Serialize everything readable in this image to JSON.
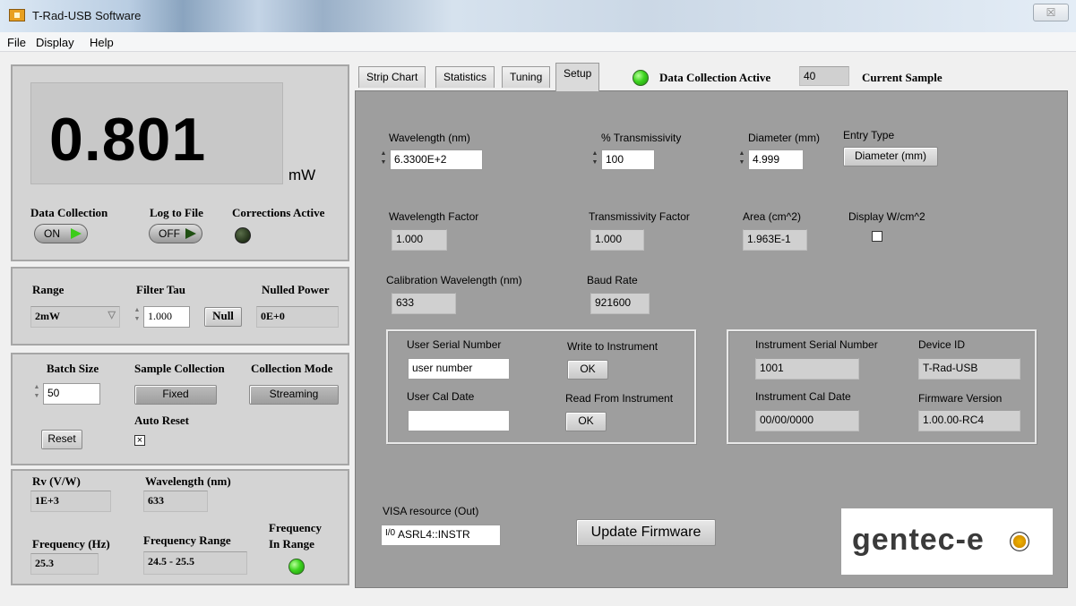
{
  "window": {
    "title": "T-Rad-USB Software",
    "close_glyph": "☒"
  },
  "menu": [
    "File",
    "Display",
    "Help"
  ],
  "power": {
    "value": "0.801",
    "unit": "mW"
  },
  "status": {
    "data_collection_label": "Data Collection",
    "data_collection_state": "ON",
    "log_label": "Log to File",
    "log_state": "OFF",
    "corrections_label": "Corrections Active"
  },
  "range_panel": {
    "range_label": "Range",
    "range_value": "2mW",
    "filter_label": "Filter Tau",
    "filter_value": "1.000",
    "null_button": "Null",
    "nulled_label": "Nulled Power",
    "nulled_value": "0E+0"
  },
  "batch_panel": {
    "batch_label": "Batch Size",
    "batch_value": "50",
    "sample_label": "Sample Collection",
    "sample_button": "Fixed",
    "mode_label": "Collection Mode",
    "mode_button": "Streaming",
    "auto_reset_label": "Auto Reset",
    "auto_reset_mark": "×",
    "reset_button": "Reset"
  },
  "info_panel": {
    "rv_label": "Rv (V/W)",
    "rv_value": "1E+3",
    "wl_label": "Wavelength (nm)",
    "wl_value": "633",
    "freq_label": "Frequency (Hz)",
    "freq_value": "25.3",
    "range_label": "Frequency Range",
    "range_value": "24.5 - 25.5",
    "in_range_label_1": "Frequency",
    "in_range_label_2": "In Range"
  },
  "tabs": [
    "Strip Chart",
    "Statistics",
    "Tuning",
    "Setup"
  ],
  "header": {
    "active_label": "Data Collection Active",
    "sample_value": "40",
    "sample_label": "Current Sample"
  },
  "setup": {
    "wavelength_label": "Wavelength (nm)",
    "wavelength_value": "6.3300E+2",
    "transmissivity_label": "% Transmissivity",
    "transmissivity_value": "100",
    "diameter_label": "Diameter (mm)",
    "diameter_value": "4.999",
    "entry_type_label": "Entry Type",
    "entry_type_value": "Diameter (mm)",
    "wl_factor_label": "Wavelength Factor",
    "wl_factor_value": "1.000",
    "trans_factor_label": "Transmissivity Factor",
    "trans_factor_value": "1.000",
    "area_label": "Area (cm^2)",
    "area_value": "1.963E-1",
    "display_wcm_label": "Display W/cm^2",
    "cal_wl_label": "Calibration Wavelength (nm)",
    "cal_wl_value": "633",
    "baud_label": "Baud Rate",
    "baud_value": "921600",
    "user_serial_label": "User Serial Number",
    "user_serial_value": "user number",
    "write_label": "Write to Instrument",
    "write_button": "OK",
    "user_cal_label": "User Cal Date",
    "user_cal_value": "",
    "read_label": "Read From Instrument",
    "read_button": "OK",
    "inst_serial_label": "Instrument  Serial Number",
    "inst_serial_value": "1001",
    "device_id_label": "Device ID",
    "device_id_value": "T-Rad-USB",
    "inst_cal_label": "Instrument Cal Date",
    "inst_cal_value": "00/00/0000",
    "firmware_label": "Firmware Version",
    "firmware_value": "1.00.00-RC4",
    "visa_label": "VISA resource (Out)",
    "visa_value": "ASRL4::INSTR",
    "update_button": "Update Firmware",
    "logo_text": "gentec-e"
  }
}
